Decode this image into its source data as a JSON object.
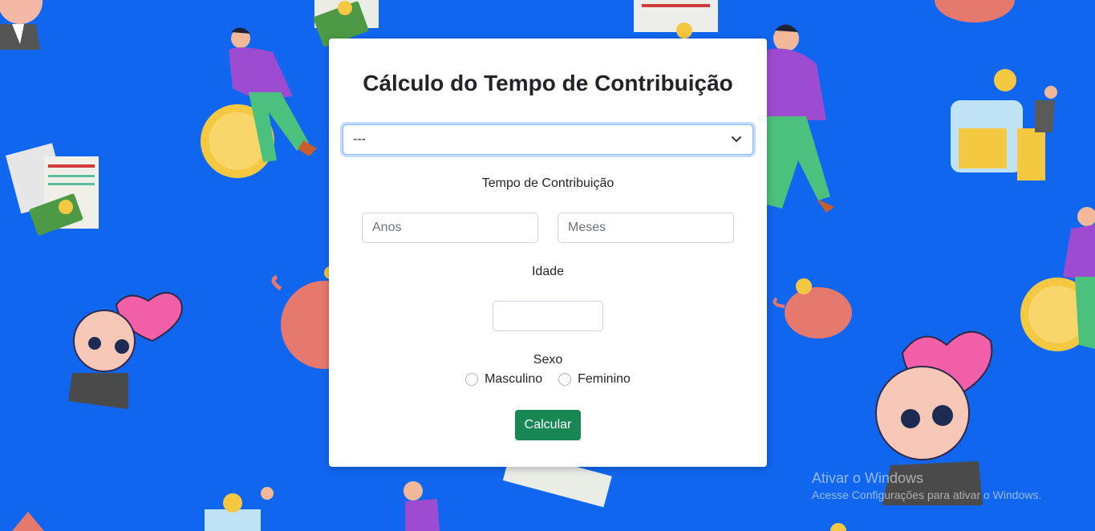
{
  "form": {
    "title": "Cálculo do Tempo de Contribuição",
    "select_value": "---",
    "tempo_label": "Tempo de Contribuição",
    "anos_placeholder": "Anos",
    "meses_placeholder": "Meses",
    "idade_label": "Idade",
    "idade_value": "",
    "sexo_label": "Sexo",
    "radio_masculino": "Masculino",
    "radio_feminino": "Feminino",
    "submit_label": "Calcular"
  },
  "watermark": {
    "line1": "Ativar o Windows",
    "line2": "Acesse Configurações para ativar o Windows."
  },
  "colors": {
    "background": "#1166f0",
    "button": "#198754",
    "focus_border": "#86b7fe"
  }
}
